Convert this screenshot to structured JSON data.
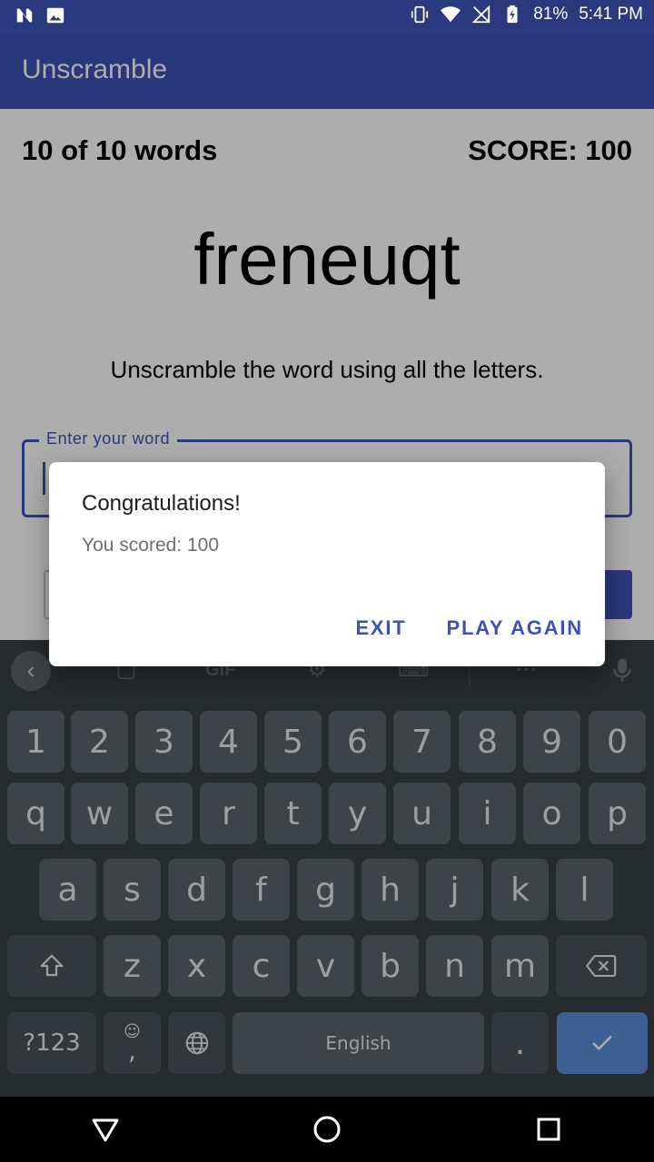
{
  "status_bar": {
    "battery": "81%",
    "time": "5:41 PM",
    "icons": [
      "n-icon",
      "image-icon",
      "vibrate-icon",
      "wifi-icon",
      "no-sim-icon",
      "battery-charging-icon"
    ]
  },
  "app_bar": {
    "title": "Unscramble"
  },
  "game": {
    "word_count": "10 of 10 words",
    "score": "SCORE: 100",
    "scrambled_word": "freneuqt",
    "instructions": "Unscramble the word using all the letters.",
    "input": {
      "label": "Enter your word",
      "value": ""
    }
  },
  "dialog": {
    "title": "Congratulations!",
    "message": "You scored: 100",
    "exit_label": "EXIT",
    "play_again_label": "PLAY AGAIN"
  },
  "keyboard": {
    "toolbar_icons": [
      "back-chevron-icon",
      "sticker-icon",
      "gif-icon",
      "gear-icon",
      "keyboard-icon",
      "more-icon",
      "mic-icon"
    ],
    "number_row": [
      "1",
      "2",
      "3",
      "4",
      "5",
      "6",
      "7",
      "8",
      "9",
      "0"
    ],
    "row1": [
      "q",
      "w",
      "e",
      "r",
      "t",
      "y",
      "u",
      "i",
      "o",
      "p"
    ],
    "row2": [
      "a",
      "s",
      "d",
      "f",
      "g",
      "h",
      "j",
      "k",
      "l"
    ],
    "row3": [
      "z",
      "x",
      "c",
      "v",
      "b",
      "n",
      "m"
    ],
    "symbols_label": "?123",
    "comma_label": ",",
    "space_label": "English",
    "period_label": "."
  },
  "colors": {
    "primary": "#3f51b5",
    "status_bar": "#2b3a7e",
    "keyboard_bg": "#394045",
    "key_bg": "#5c6469",
    "enter_key": "#5b8cd6"
  }
}
